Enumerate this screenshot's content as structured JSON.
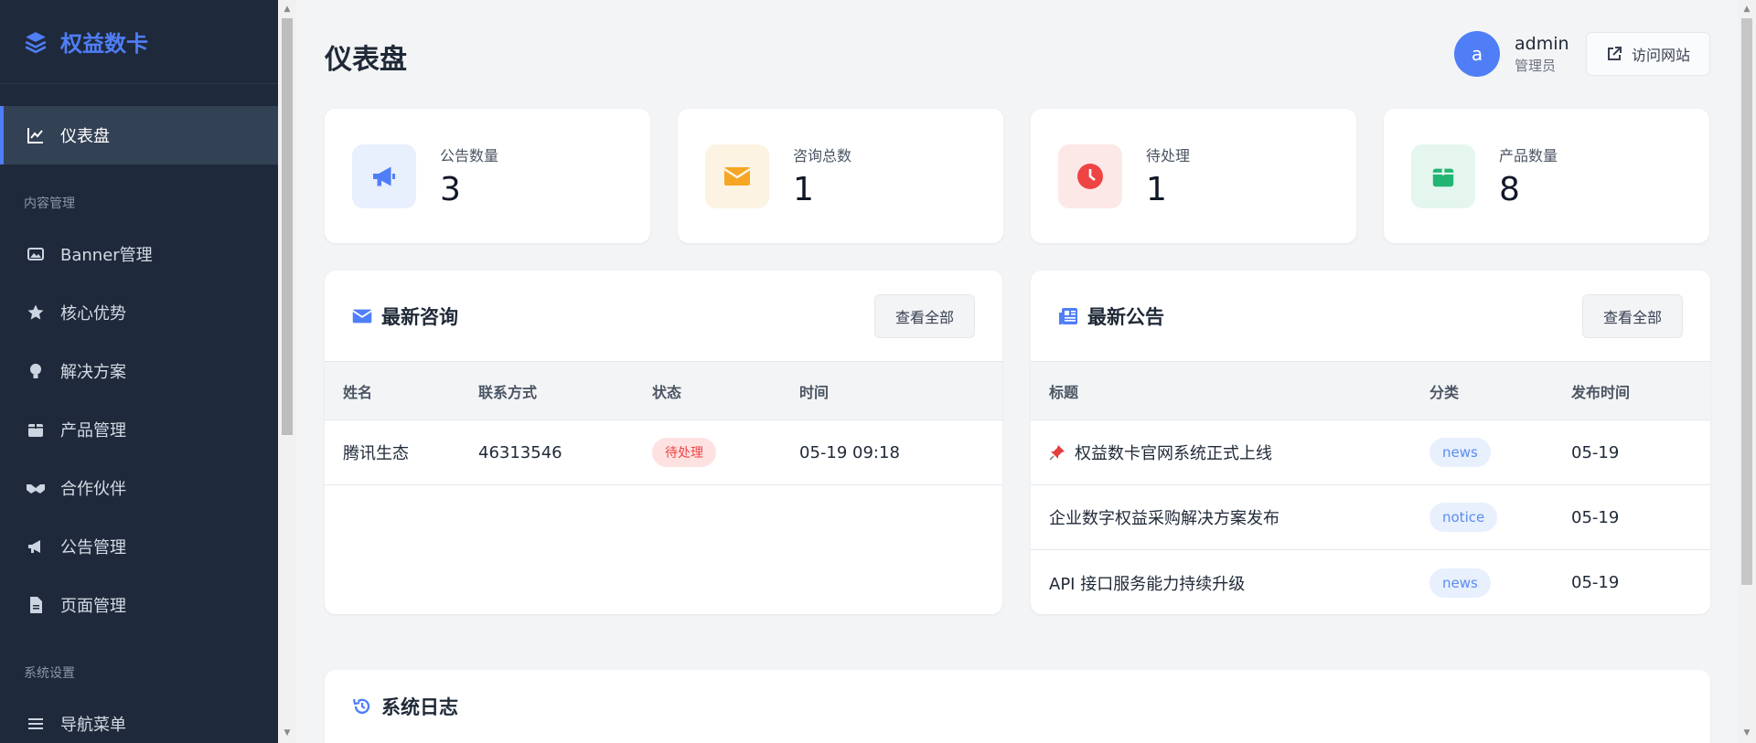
{
  "brand": {
    "name": "权益数卡"
  },
  "sidebar": {
    "items": [
      {
        "label": "仪表盘",
        "icon": "chart-line-icon",
        "active": true
      },
      {
        "section": "内容管理"
      },
      {
        "label": "Banner管理",
        "icon": "image-icon"
      },
      {
        "label": "核心优势",
        "icon": "star-icon"
      },
      {
        "label": "解决方案",
        "icon": "lightbulb-icon"
      },
      {
        "label": "产品管理",
        "icon": "box-icon"
      },
      {
        "label": "合作伙伴",
        "icon": "handshake-icon"
      },
      {
        "label": "公告管理",
        "icon": "megaphone-icon"
      },
      {
        "label": "页面管理",
        "icon": "file-icon"
      },
      {
        "section": "系统设置"
      },
      {
        "label": "导航菜单",
        "icon": "menu-icon"
      }
    ]
  },
  "header": {
    "title": "仪表盘",
    "avatar_letter": "a",
    "user_name": "admin",
    "user_role": "管理员",
    "visit_label": "访问网站"
  },
  "stats": [
    {
      "label": "公告数量",
      "value": "3",
      "icon": "megaphone-icon",
      "color": "#4f7ef7",
      "bg": "#e8effd"
    },
    {
      "label": "咨询总数",
      "value": "1",
      "icon": "envelope-icon",
      "color": "#f5a623",
      "bg": "#fdf3e3"
    },
    {
      "label": "待处理",
      "value": "1",
      "icon": "clock-icon",
      "color": "#ef4444",
      "bg": "#fde8e8"
    },
    {
      "label": "产品数量",
      "value": "8",
      "icon": "box-icon",
      "color": "#22b573",
      "bg": "#e4f6ee"
    }
  ],
  "inquiries": {
    "title": "最新咨询",
    "view_all": "查看全部",
    "columns": [
      "姓名",
      "联系方式",
      "状态",
      "时间"
    ],
    "rows": [
      {
        "name": "腾讯生态",
        "contact": "46313546",
        "status": "待处理",
        "time": "05-19 09:18"
      }
    ]
  },
  "announcements": {
    "title": "最新公告",
    "view_all": "查看全部",
    "columns": [
      "标题",
      "分类",
      "发布时间"
    ],
    "rows": [
      {
        "pinned": true,
        "title": "权益数卡官网系统正式上线",
        "category": "news",
        "date": "05-19"
      },
      {
        "pinned": false,
        "title": "企业数字权益采购解决方案发布",
        "category": "notice",
        "date": "05-19"
      },
      {
        "pinned": false,
        "title": "API 接口服务能力持续升级",
        "category": "news",
        "date": "05-19"
      }
    ]
  },
  "log": {
    "title": "系统日志"
  },
  "colors": {
    "accent": "#4f7ef7",
    "sidebar_bg": "#1e293b"
  }
}
